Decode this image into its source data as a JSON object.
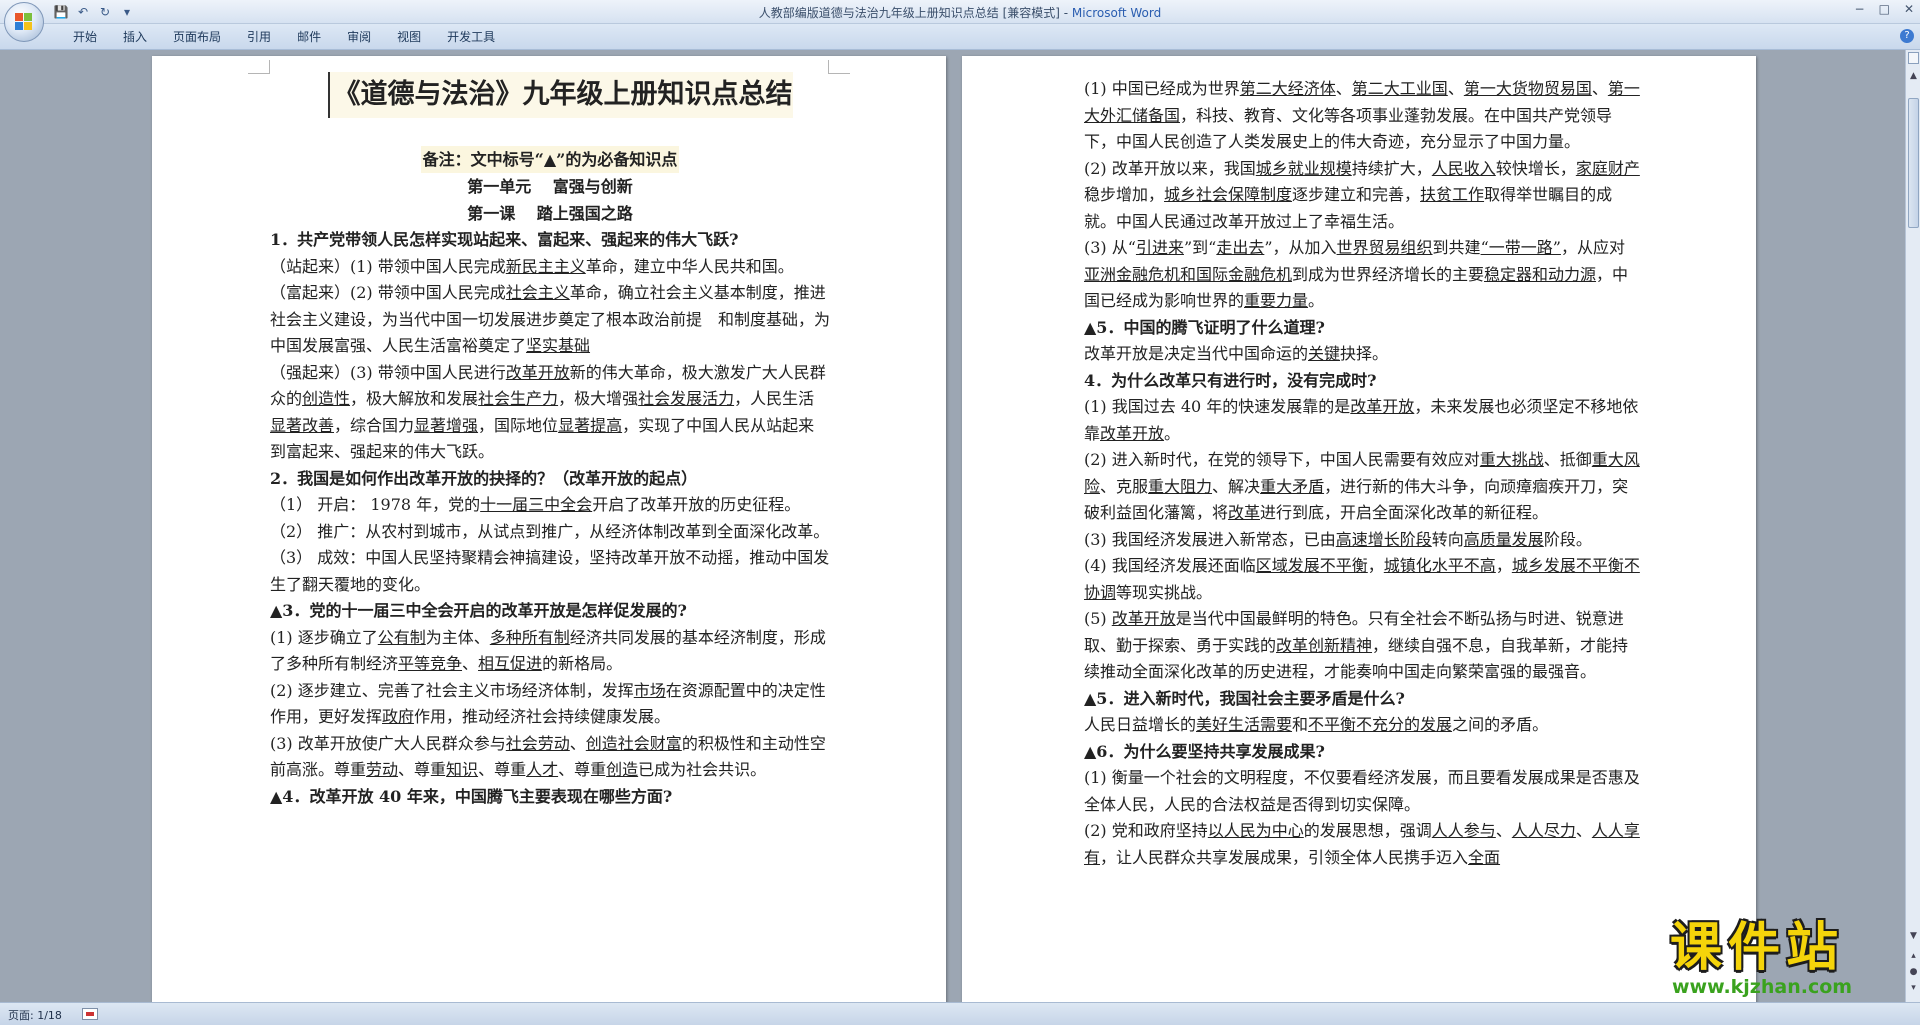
{
  "window": {
    "title_doc": "人教部编版道德与法治九年级上册知识点总结 [兼容模式] - ",
    "title_app": "Microsoft Word"
  },
  "ribbon": {
    "tabs": [
      "开始",
      "插入",
      "页面布局",
      "引用",
      "邮件",
      "审阅",
      "视图",
      "开发工具"
    ]
  },
  "status": {
    "page": "页面: 1/18"
  },
  "watermark": {
    "main": "课件站",
    "url": "www.kjzhan.com"
  },
  "left_page": {
    "title": "《道德与法治》九年级上册知识点总结",
    "note": "备注：文中标号“▲”的为必备知识点",
    "unit": "第一单元　 富强与创新",
    "lesson": "第一课　 踏上强国之路",
    "lines": [
      {
        "cls": "q",
        "html": "1．共产党带领人民怎样实现站起来、富起来、强起来的伟大飞跃?"
      },
      {
        "cls": "",
        "html": "（站起来）(1) 带领中国人民完成<u>新民主主义</u>革命，建立中华人民共和国。"
      },
      {
        "cls": "",
        "html": "（富起来）(2) 带领中国人民完成<u>社会主义</u>革命，确立社会主义基本制度，推进社会主义建设，为当代中国一切发展进步奠定了根本政治前提　和制度基础，为中国发展富强、人民生活富裕奠定了<u>坚实基础</u>"
      },
      {
        "cls": "",
        "html": "（强起来）(3) 带领中国人民进行<u>改革开放</u>新的伟大革命，极大激发广大人民群众的<u>创造性</u>，极大解放和发展<u>社会生产力</u>，极大增强<u>社会发展活力</u>，人民生活<u>显著改善</u>，综合国力<u>显著增强</u>，国际地位<u>显著提高</u>，实现了中国人民从站起来到富起来、强起来的伟大飞跃。"
      },
      {
        "cls": "q",
        "html": "2．我国是如何作出改革开放的抉择的？（改革开放的起点）"
      },
      {
        "cls": "",
        "html": "（1） 开启： 1978 年，党的<u>十一届三中全会</u>开启了改革开放的历史征程。"
      },
      {
        "cls": "",
        "html": "（2） 推广：从农村到城市，从试点到推广，从经济体制改革到全面深化改革。"
      },
      {
        "cls": "",
        "html": "（3） 成效：中国人民坚持聚精会神搞建设，坚持改革开放不动摇，推动中国发生了翻天覆地的变化。"
      },
      {
        "cls": "q",
        "html": "▲3．党的十一届三中全会开启的改革开放是怎样促发展的?"
      },
      {
        "cls": "",
        "html": "(1) 逐步确立了<u>公有制</u>为主体、<u>多种所有制</u>经济共同发展的基本经济制度，形成了多种所有制经济<u>平等竞争</u>、<u>相互促进</u>的新格局。"
      },
      {
        "cls": "",
        "html": "(2) 逐步建立、完善了社会主义市场经济体制，发挥<u>市场</u>在资源配置中的决定性作用，更好发挥<u>政府</u>作用，推动经济社会持续健康发展。"
      },
      {
        "cls": "",
        "html": "(3) 改革开放使广大人民群众参与<u>社会劳动</u>、<u>创造社会财富</u>的积极性和主动性空前高涨。尊重<u>劳动</u>、尊重<u>知识</u>、尊重<u>人才</u>、尊重<u>创造</u>已成为社会共识。"
      },
      {
        "cls": "q",
        "html": "▲4．改革开放 40 年来，中国腾飞主要表现在哪些方面?"
      }
    ]
  },
  "right_page": {
    "lines": [
      {
        "cls": "",
        "html": "(1) 中国已经成为世界<u>第二大经济体</u>、<u>第二大工业国</u>、<u>第一大货物贸易国</u>、<u>第一大外汇储备国</u>，科技、教育、文化等各项事业蓬勃发展。在中国共产党领导下，中国人民创造了人类发展史上的伟大奇迹，充分显示了中国力量。"
      },
      {
        "cls": "",
        "html": "(2) 改革开放以来，我国<u>城乡就业规模</u>持续扩大，<u>人民收入</u>较快增长，<u>家庭财产</u>稳步增加，<u>城乡社会保障制度</u>逐步建立和完善，<u>扶贫工作</u>取得举世瞩目的成就。中国人民通过改革开放过上了幸福生活。"
      },
      {
        "cls": "",
        "html": "(3) 从“<u>引进来</u>”到“<u>走出去</u>”，从加入<u>世界贸易组织</u>到共建<u>“一带一路”</u>，从应对<u>亚洲金融危机和国际金融危机</u>到成为世界经济增长的主要<u>稳定器和动力源</u>，中国已经成为影响世界的<u>重要力量</u>。"
      },
      {
        "cls": "q",
        "html": "▲5．中国的腾飞证明了什么道理?"
      },
      {
        "cls": "",
        "html": "改革开放是决定当代中国命运的<u>关键</u>抉择。"
      },
      {
        "cls": "q",
        "html": "4．为什么改革只有进行时，没有完成时?"
      },
      {
        "cls": "",
        "html": "(1) 我国过去 40 年的快速发展靠的是<u>改革开放</u>，未来发展也必须坚定不移地依靠<u>改革开放</u>。"
      },
      {
        "cls": "",
        "html": "(2) 进入新时代，在党的领导下，中国人民需要有效应对<u>重大挑战</u>、抵御<u>重大风险</u>、克服<u>重大阻力</u>、解决<u>重大矛盾</u>，进行新的伟大斗争，向顽瘴痼疾开刀，突破利益固化藩篱，将<u>改革</u>进行到底，开启全面深化改革的新征程。"
      },
      {
        "cls": "",
        "html": "(3) 我国经济发展进入新常态，已由<u>高速增长阶段</u>转向<u>高质量发展</u>阶段。"
      },
      {
        "cls": "",
        "html": "(4) 我国经济发展还面临<u>区域发展不平衡</u>，<u>城镇化水平不高</u>，<u>城乡发展不平衡不协调</u>等现实挑战。"
      },
      {
        "cls": "",
        "html": "(5) <u>改革开放</u>是当代中国最鲜明的特色。只有全社会不断弘扬与时进、锐意进取、勤于探索、勇于实践的<u>改革创新精神</u>，继续自强不息，自我革新，才能持续推动全面深化改革的历史进程，才能奏响中国走向繁荣富强的最强音。"
      },
      {
        "cls": "q",
        "html": "▲5．进入新时代，我国社会主要矛盾是什么?"
      },
      {
        "cls": "",
        "html": "人民日益增长的<u>美好生活需要</u>和<u>不平衡不充分的发展</u>之间的矛盾。"
      },
      {
        "cls": "q",
        "html": "▲6．为什么要坚持共享发展成果?"
      },
      {
        "cls": "",
        "html": "(1) 衡量一个社会的文明程度，不仅要看经济发展，而且要看发展成果是否惠及全体人民，人民的合法权益是否得到切实保障。"
      },
      {
        "cls": "",
        "html": "(2) 党和政府坚持<u>以人民为中心</u>的发展思想，强调<u>人人参与</u>、<u>人人尽力</u>、<u>人人享有</u>，让人民群众共享发展成果，引领全体人民携手迈入<u>全面</u>"
      }
    ]
  }
}
